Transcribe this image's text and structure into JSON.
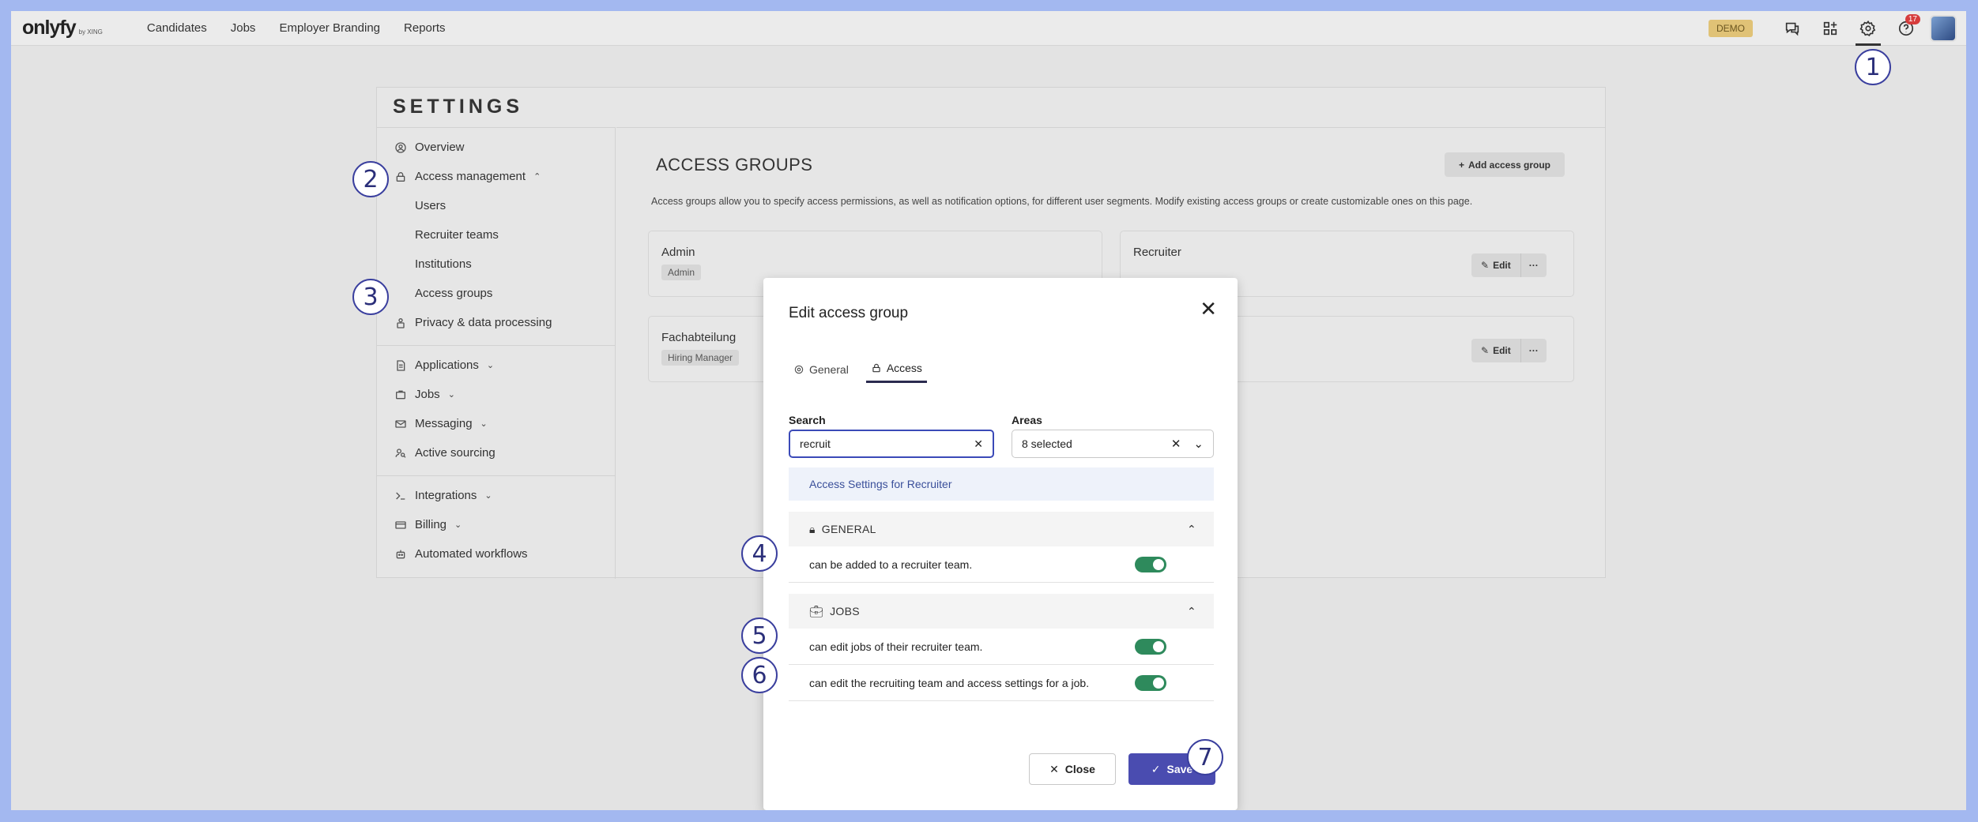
{
  "brand": {
    "logo": "onlyfy",
    "logo_sub": "by XING"
  },
  "nav": {
    "items": [
      "Candidates",
      "Jobs",
      "Employer Branding",
      "Reports"
    ]
  },
  "topbar": {
    "demo_label": "DEMO",
    "notification_count": "17"
  },
  "settings": {
    "title": "SETTINGS",
    "sidebar": {
      "overview": "Overview",
      "access_management": "Access management",
      "users": "Users",
      "recruiter_teams": "Recruiter teams",
      "institutions": "Institutions",
      "access_groups": "Access groups",
      "privacy": "Privacy & data processing",
      "applications": "Applications",
      "jobs": "Jobs",
      "messaging": "Messaging",
      "active_sourcing": "Active sourcing",
      "integrations": "Integrations",
      "billing": "Billing",
      "automated_workflows": "Automated workflows"
    }
  },
  "content": {
    "title": "ACCESS GROUPS",
    "add_button": "Add access group",
    "description": "Access groups allow you to specify access permissions, as well as notification options, for different user segments. Modify existing access groups or create customizable ones on this page.",
    "cards": [
      {
        "name": "Admin",
        "tag": "Admin"
      },
      {
        "name": "Recruiter",
        "edit": "Edit"
      },
      {
        "name": "Fachabteilung",
        "tag": "Hiring Manager"
      },
      {
        "edit": "Edit"
      }
    ],
    "more_label": "···"
  },
  "modal": {
    "title": "Edit access group",
    "tabs": {
      "general": "General",
      "access": "Access"
    },
    "search_label": "Search",
    "search_value": "recruit",
    "areas_label": "Areas",
    "areas_value": "8 selected",
    "section_link": "Access Settings for Recruiter",
    "groups": [
      {
        "title": "GENERAL",
        "permissions": [
          {
            "text": "can be added to a recruiter team.",
            "enabled": true
          }
        ]
      },
      {
        "title": "JOBS",
        "permissions": [
          {
            "text": "can edit jobs of their recruiter team.",
            "enabled": true
          },
          {
            "text": "can edit the recruiting team and access settings for a job.",
            "enabled": true
          }
        ]
      }
    ],
    "close_button": "Close",
    "save_button": "Save"
  },
  "markers": [
    "1",
    "2",
    "3",
    "4",
    "5",
    "6",
    "7"
  ],
  "colors": {
    "marker_border": "#3a3f9e",
    "save_button": "#4a4cb0",
    "toggle_on": "#2e8a5c",
    "background": "#a3b8f0"
  }
}
